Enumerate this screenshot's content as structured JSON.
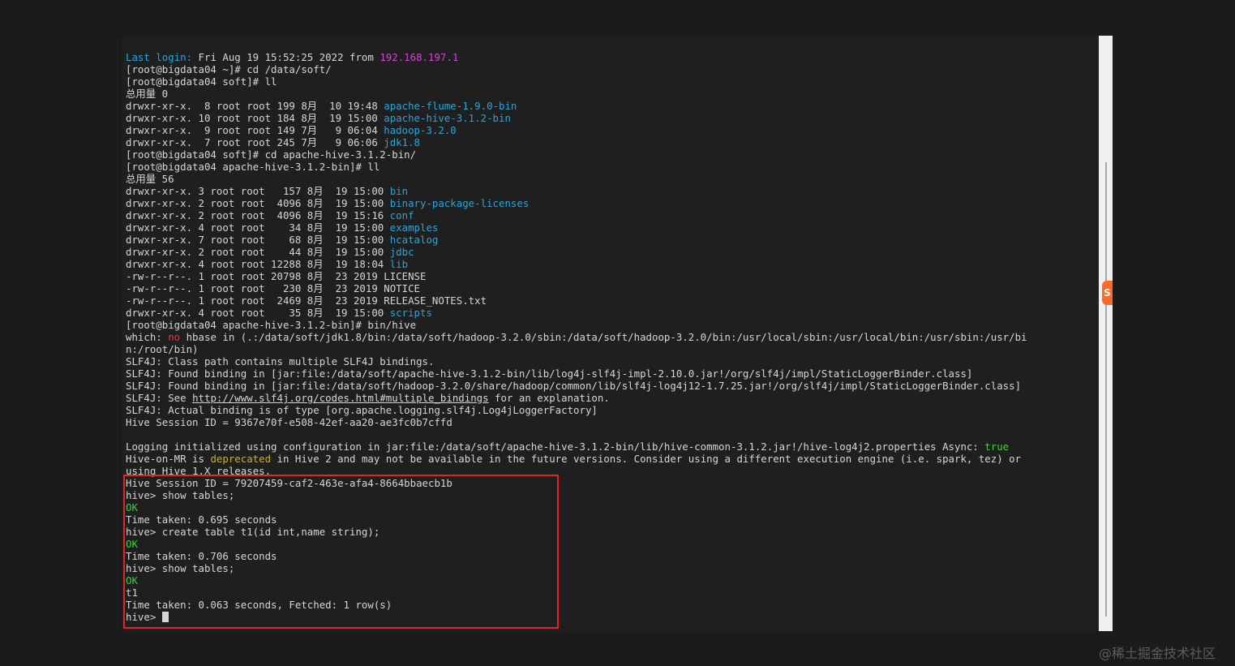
{
  "terminal": {
    "lines": [
      [
        {
          "t": "Last login:",
          "c": "cyan"
        },
        {
          "t": " Fri Aug 19 15:52:25 2022 from "
        },
        {
          "t": "192.168.197.1",
          "c": "magenta"
        }
      ],
      [
        {
          "t": "[root@bigdata04 ~]# cd /data/soft/"
        }
      ],
      [
        {
          "t": "[root@bigdata04 soft]# ll"
        }
      ],
      [
        {
          "t": "总用量 0"
        }
      ],
      [
        {
          "t": "drwxr-xr-x.  8 root root 199 8月  10 19:48 "
        },
        {
          "t": "apache-flume-1.9.0-bin",
          "c": "cyan"
        }
      ],
      [
        {
          "t": "drwxr-xr-x. 10 root root 184 8月  19 15:00 "
        },
        {
          "t": "apache-hive-3.1.2-bin",
          "c": "cyan"
        }
      ],
      [
        {
          "t": "drwxr-xr-x.  9 root root 149 7月   9 06:04 "
        },
        {
          "t": "hadoop-3.2.0",
          "c": "cyan"
        }
      ],
      [
        {
          "t": "drwxr-xr-x.  7 root root 245 7月   9 06:06 "
        },
        {
          "t": "jdk1.8",
          "c": "cyan"
        }
      ],
      [
        {
          "t": "[root@bigdata04 soft]# cd apache-hive-3.1.2-bin/"
        }
      ],
      [
        {
          "t": "[root@bigdata04 apache-hive-3.1.2-bin]# ll"
        }
      ],
      [
        {
          "t": "总用量 56"
        }
      ],
      [
        {
          "t": "drwxr-xr-x. 3 root root   157 8月  19 15:00 "
        },
        {
          "t": "bin",
          "c": "cyan"
        }
      ],
      [
        {
          "t": "drwxr-xr-x. 2 root root  4096 8月  19 15:00 "
        },
        {
          "t": "binary-package-licenses",
          "c": "cyan"
        }
      ],
      [
        {
          "t": "drwxr-xr-x. 2 root root  4096 8月  19 15:16 "
        },
        {
          "t": "conf",
          "c": "cyan"
        }
      ],
      [
        {
          "t": "drwxr-xr-x. 4 root root    34 8月  19 15:00 "
        },
        {
          "t": "examples",
          "c": "cyan"
        }
      ],
      [
        {
          "t": "drwxr-xr-x. 7 root root    68 8月  19 15:00 "
        },
        {
          "t": "hcatalog",
          "c": "cyan"
        }
      ],
      [
        {
          "t": "drwxr-xr-x. 2 root root    44 8月  19 15:00 "
        },
        {
          "t": "jdbc",
          "c": "cyan"
        }
      ],
      [
        {
          "t": "drwxr-xr-x. 4 root root 12288 8月  19 18:04 "
        },
        {
          "t": "lib",
          "c": "cyan"
        }
      ],
      [
        {
          "t": "-rw-r--r--. 1 root root 20798 8月  23 2019 LICENSE"
        }
      ],
      [
        {
          "t": "-rw-r--r--. 1 root root   230 8月  23 2019 NOTICE"
        }
      ],
      [
        {
          "t": "-rw-r--r--. 1 root root  2469 8月  23 2019 RELEASE_NOTES.txt"
        }
      ],
      [
        {
          "t": "drwxr-xr-x. 4 root root    35 8月  19 15:00 "
        },
        {
          "t": "scripts",
          "c": "cyan"
        }
      ],
      [
        {
          "t": "[root@bigdata04 apache-hive-3.1.2-bin]# bin/hive"
        }
      ],
      [
        {
          "t": "which: "
        },
        {
          "t": "no",
          "c": "red"
        },
        {
          "t": " hbase in (.:/data/soft/jdk1.8/bin:/data/soft/hadoop-3.2.0/sbin:/data/soft/hadoop-3.2.0/bin:/usr/local/sbin:/usr/local/bin:/usr/sbin:/usr/bi"
        }
      ],
      [
        {
          "t": "n:/root/bin)"
        }
      ],
      [
        {
          "t": "SLF4J: Class path contains multiple SLF4J bindings."
        }
      ],
      [
        {
          "t": "SLF4J: Found binding in [jar:file:/data/soft/apache-hive-3.1.2-bin/lib/log4j-slf4j-impl-2.10.0.jar!/org/slf4j/impl/StaticLoggerBinder.class]"
        }
      ],
      [
        {
          "t": "SLF4J: Found binding in [jar:file:/data/soft/hadoop-3.2.0/share/hadoop/common/lib/slf4j-log4j12-1.7.25.jar!/org/slf4j/impl/StaticLoggerBinder.class]"
        }
      ],
      [
        {
          "t": "SLF4J: See "
        },
        {
          "t": "http://www.slf4j.org/codes.html#multiple_bindings",
          "c": "link"
        },
        {
          "t": " for an explanation."
        }
      ],
      [
        {
          "t": "SLF4J: Actual binding is of type [org.apache.logging.slf4j.Log4jLoggerFactory]"
        }
      ],
      [
        {
          "t": "Hive Session ID = 9367e70f-e508-42ef-aa20-ae3fc0b7cffd"
        }
      ],
      [
        {
          "t": ""
        }
      ],
      [
        {
          "t": "Logging initialized using configuration in jar:file:/data/soft/apache-hive-3.1.2-bin/lib/hive-common-3.1.2.jar!/hive-log4j2.properties Async: "
        },
        {
          "t": "true",
          "c": "green"
        }
      ],
      [
        {
          "t": "Hive-on-MR is "
        },
        {
          "t": "deprecated",
          "c": "yellow"
        },
        {
          "t": " in Hive 2 and may not be available in the future versions. Consider using a different execution engine (i.e. spark, tez) or"
        }
      ],
      [
        {
          "t": "using Hive 1.X releases."
        }
      ],
      [
        {
          "t": "Hive Session ID = 79207459-caf2-463e-afa4-8664bbaecb1b"
        }
      ],
      [
        {
          "t": "hive> show tables;"
        }
      ],
      [
        {
          "t": "OK",
          "c": "green"
        }
      ],
      [
        {
          "t": "Time taken: 0.695 seconds"
        }
      ],
      [
        {
          "t": "hive> create table t1(id int,name string);"
        }
      ],
      [
        {
          "t": "OK",
          "c": "green"
        }
      ],
      [
        {
          "t": "Time taken: 0.706 seconds"
        }
      ],
      [
        {
          "t": "hive> show tables;"
        }
      ],
      [
        {
          "t": "OK",
          "c": "green"
        }
      ],
      [
        {
          "t": "t1"
        }
      ],
      [
        {
          "t": "Time taken: 0.063 seconds, Fetched: 1 row(s)"
        }
      ],
      [
        {
          "t": "hive> "
        },
        {
          "t": "",
          "c": "cursor"
        }
      ]
    ]
  },
  "watermark": "@稀土掘金技术社区",
  "colors": {
    "cyan": "#2aa4d8",
    "magenta": "#d540d5",
    "red": "#e23c3c",
    "green": "#3ccf3c",
    "yellow": "#c9b21f",
    "highlight": "#e0262a"
  }
}
